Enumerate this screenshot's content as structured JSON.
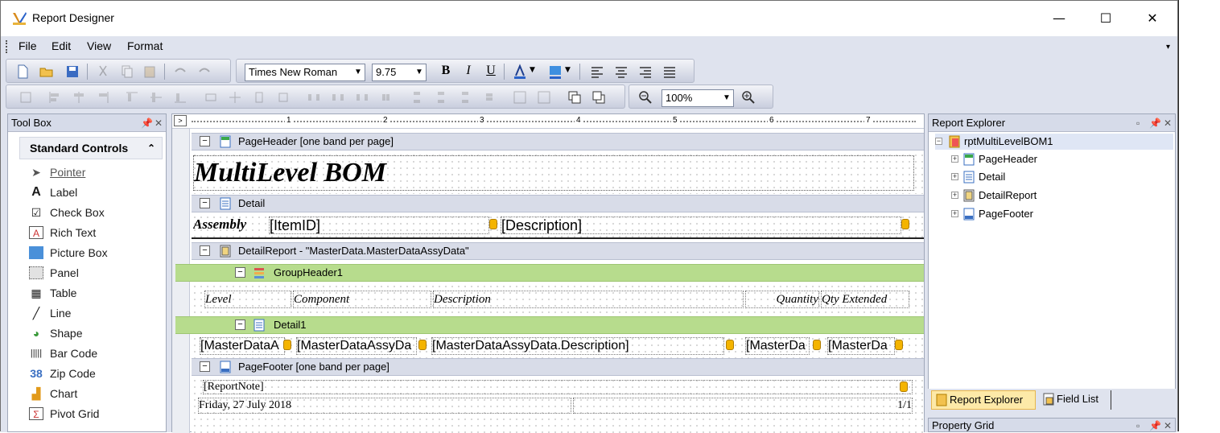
{
  "window": {
    "title": "Report Designer",
    "minimize": "—",
    "maximize": "☐",
    "close": "✕"
  },
  "menu": {
    "file": "File",
    "edit": "Edit",
    "view": "View",
    "format": "Format"
  },
  "toolbar": {
    "font_name": "Times New Roman",
    "font_size": "9.75",
    "bold": "B",
    "italic": "I",
    "underline": "U",
    "zoom": "100%"
  },
  "toolbox": {
    "title": "Tool Box",
    "group": "Standard Controls",
    "items": [
      {
        "label": "Pointer",
        "icon": "pointer-icon"
      },
      {
        "label": "Label",
        "icon": "label-icon"
      },
      {
        "label": "Check Box",
        "icon": "checkbox-icon"
      },
      {
        "label": "Rich Text",
        "icon": "richtext-icon"
      },
      {
        "label": "Picture Box",
        "icon": "picture-icon"
      },
      {
        "label": "Panel",
        "icon": "panel-icon"
      },
      {
        "label": "Table",
        "icon": "table-icon"
      },
      {
        "label": "Line",
        "icon": "line-icon"
      },
      {
        "label": "Shape",
        "icon": "shape-icon"
      },
      {
        "label": "Bar Code",
        "icon": "barcode-icon"
      },
      {
        "label": "Zip Code",
        "icon": "zipcode-icon"
      },
      {
        "label": "Chart",
        "icon": "chart-icon"
      },
      {
        "label": "Pivot Grid",
        "icon": "pivotgrid-icon"
      }
    ]
  },
  "ruler": {
    "marks": [
      "1",
      "2",
      "3",
      "4",
      "5",
      "6",
      "7"
    ]
  },
  "bands": {
    "page_header": "PageHeader [one band per page]",
    "detail": "Detail",
    "detail_report": "DetailReport - \"MasterData.MasterDataAssyData\"",
    "group_header": "GroupHeader1",
    "detail1": "Detail1",
    "page_footer": "PageFooter [one band per page]"
  },
  "report": {
    "title": "MultiLevel BOM",
    "assembly_label": "Assembly",
    "item_id": "[ItemID]",
    "description": "[Description]",
    "col_level": "Level",
    "col_component": "Component",
    "col_description": "Description",
    "col_quantity": "Quantity",
    "col_qty_extended": "Qty Extended",
    "d1_field1": "[MasterDataA",
    "d1_field2": "[MasterDataAssyDa",
    "d1_field3": "[MasterDataAssyData.Description]",
    "d1_field4": "[MasterDa",
    "d1_field5": "[MasterDa",
    "report_note": "[ReportNote]",
    "footer_date": "Friday, 27 July 2018",
    "page_number": "1/1"
  },
  "explorer": {
    "title": "Report Explorer",
    "root": "rptMultiLevelBOM1",
    "nodes": [
      "PageHeader",
      "Detail",
      "DetailReport",
      "PageFooter"
    ]
  },
  "tabs": {
    "report_explorer": "Report Explorer",
    "field_list": "Field List"
  },
  "property_grid": {
    "title": "Property Grid"
  },
  "colors": {
    "band_green": "#b7dc8d",
    "band_gray": "#d8dce8",
    "panel_bg": "#dfe3ee",
    "active_tab": "#fde9a8"
  }
}
